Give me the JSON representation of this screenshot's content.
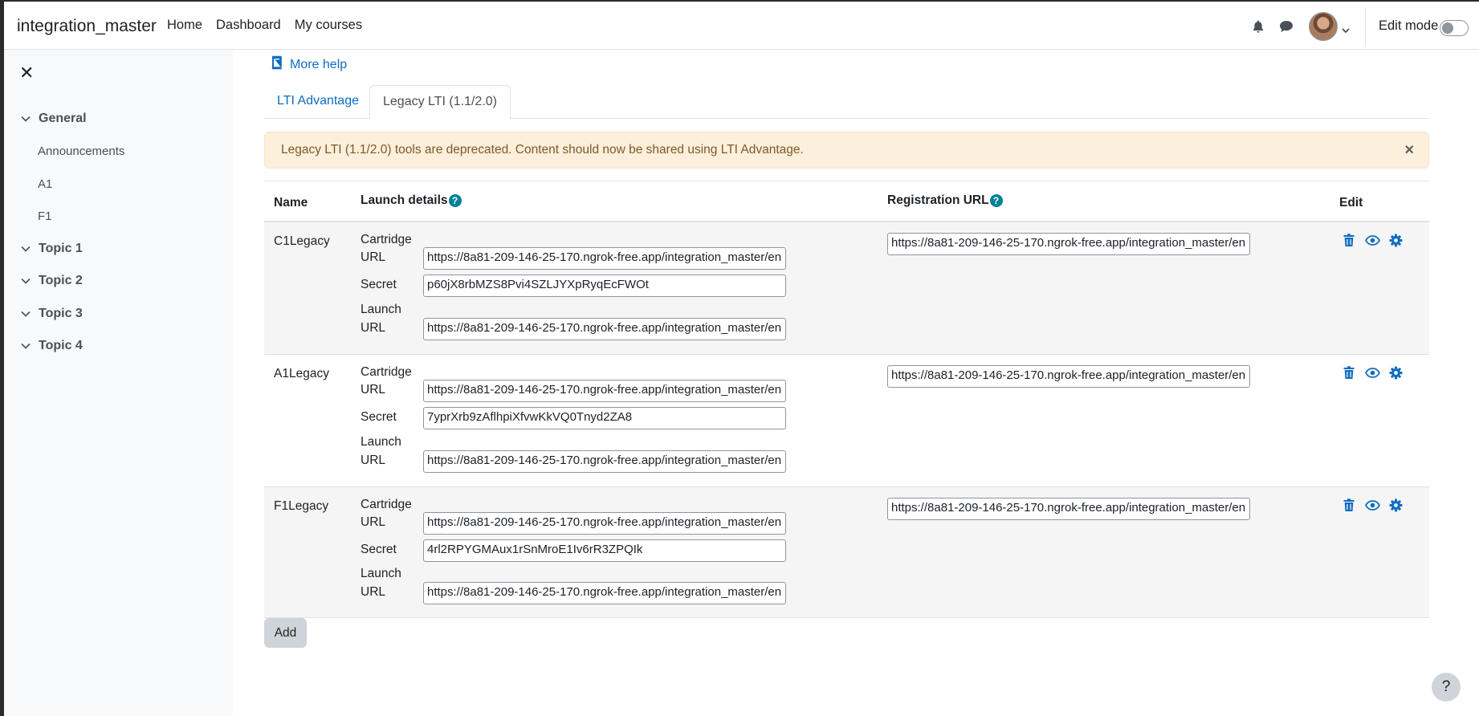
{
  "navbar": {
    "site_name": "integration_master",
    "links": [
      "Home",
      "Dashboard",
      "My courses"
    ],
    "edit_mode_label": "Edit mode",
    "edit_mode_on": false
  },
  "sidebar": {
    "close_icon": "close-icon",
    "general": "General",
    "activities": [
      "Announcements",
      "A1",
      "F1"
    ],
    "topics": [
      "Topic 1",
      "Topic 2",
      "Topic 3",
      "Topic 4"
    ]
  },
  "main": {
    "more_help": "More help",
    "tabs": [
      "LTI Advantage",
      "Legacy LTI (1.1/2.0)"
    ],
    "active_tab": "Legacy LTI (1.1/2.0)",
    "alert": "Legacy LTI (1.1/2.0) tools are deprecated. Content should now be shared using LTI Advantage.",
    "alert_close": "×",
    "table": {
      "headers": {
        "name": "Name",
        "launch_details": "Launch details",
        "registration_url": "Registration URL",
        "edit": "Edit"
      },
      "labels": {
        "cartridge_1": "Cartridge",
        "url": "URL",
        "secret": "Secret",
        "launch_1": "Launch"
      },
      "rows": [
        {
          "name": "C1Legacy",
          "cartridge_url": "https://8a81-209-146-25-170.ngrok-free.app/integration_master/en",
          "secret": "p60jX8rbMZS8Pvi4SZLJYXpRyqEcFWOt",
          "launch_url": "https://8a81-209-146-25-170.ngrok-free.app/integration_master/en",
          "registration_url": "https://8a81-209-146-25-170.ngrok-free.app/integration_master/en"
        },
        {
          "name": "A1Legacy",
          "cartridge_url": "https://8a81-209-146-25-170.ngrok-free.app/integration_master/en",
          "secret": "7yprXrb9zAflhpiXfvwKkVQ0Tnyd2ZA8",
          "launch_url": "https://8a81-209-146-25-170.ngrok-free.app/integration_master/en",
          "registration_url": "https://8a81-209-146-25-170.ngrok-free.app/integration_master/en"
        },
        {
          "name": "F1Legacy",
          "cartridge_url": "https://8a81-209-146-25-170.ngrok-free.app/integration_master/en",
          "secret": "4rl2RPYGMAux1rSnMroE1Iv6rR3ZPQIk",
          "launch_url": "https://8a81-209-146-25-170.ngrok-free.app/integration_master/en",
          "registration_url": "https://8a81-209-146-25-170.ngrok-free.app/integration_master/en"
        }
      ]
    },
    "add_button": "Add",
    "help_button": "?"
  },
  "colors": {
    "link": "#0f6cbf",
    "info_icon": "#008196",
    "alert_bg": "#fcefdc",
    "alert_text": "#7d5a29",
    "sidebar_bg": "#f8f9fa"
  }
}
